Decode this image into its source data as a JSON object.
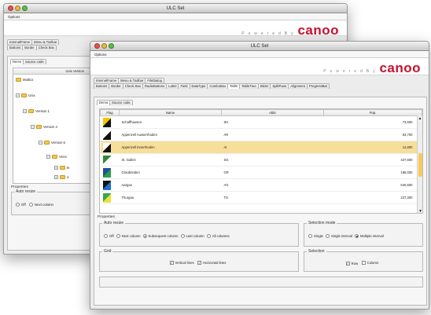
{
  "back_window": {
    "title": "ULC Set",
    "menu": "Options",
    "brand_powered": "P o w e r e d   B y",
    "brand_name": "canoo",
    "tabs_row1": [
      "InternalFrame",
      "Menu & Toolbar"
    ],
    "tabs_row2": [
      "Buttons",
      "Border",
      "Check Box"
    ],
    "subtabs": [
      "Demo",
      "Source code"
    ],
    "tree_header": "Unix Version",
    "tree": [
      "Multics",
      "Unix",
      "Version 1",
      "Version 4",
      "Version 6",
      "Versi",
      "B",
      "4"
    ],
    "properties_title": "Properties",
    "auto_resize_title": "Auto resize",
    "auto_resize_options": [
      "Off",
      "Next column"
    ]
  },
  "front_window": {
    "title": "ULC Set",
    "menu": "Options",
    "brand_powered": "P o w e r e d   B y",
    "brand_name": "canoo",
    "tabs_row1": [
      "InternalFrame",
      "Menu & Toolbar",
      "FileDialog"
    ],
    "tabs_row2": [
      "Buttons",
      "Border",
      "Check Box",
      "RadioButtons",
      "Label",
      "Field",
      "DataType",
      "ComboBox",
      "Table",
      "TableTree",
      "Slider",
      "SplitPane",
      "Alignment",
      "ProgressBar"
    ],
    "subtabs": [
      "Demo",
      "Source code"
    ],
    "table": {
      "columns": [
        "Flag",
        "Name",
        "Abbr",
        "Pop."
      ],
      "rows": [
        {
          "name": "Schaffhausen",
          "abbr": "SH",
          "pop": "73,600",
          "flag_colors": [
            "#f5c400",
            "#111111"
          ]
        },
        {
          "name": "Appenzell Ausserrhoden",
          "abbr": "AR",
          "pop": "53,700",
          "flag_colors": [
            "#ffffff",
            "#111111"
          ]
        },
        {
          "name": "Appenzell Innerrhoden",
          "abbr": "AI",
          "pop": "14,800",
          "flag_colors": [
            "#ffffff",
            "#111111"
          ]
        },
        {
          "name": "St. Gallen",
          "abbr": "SG",
          "pop": "447,600",
          "flag_colors": [
            "#2e8b3a",
            "#ffffff"
          ]
        },
        {
          "name": "Graubünden",
          "abbr": "GR",
          "pop": "186,000",
          "flag_colors": [
            "#1e4fa0",
            "#2e9a4a"
          ]
        },
        {
          "name": "Aargau",
          "abbr": "AG",
          "pop": "540,600",
          "flag_colors": [
            "#111111",
            "#1f6fd0"
          ]
        },
        {
          "name": "Thurgau",
          "abbr": "TG",
          "pop": "227,300",
          "flag_colors": [
            "#3aa64a",
            "#e8e23a"
          ]
        }
      ]
    },
    "properties_title": "Properties",
    "auto_resize": {
      "title": "Auto resize",
      "options": [
        "Off",
        "Next column",
        "Subsequent column",
        "Last column",
        "All columns"
      ],
      "selected": "Subsequent column"
    },
    "selection_mode": {
      "title": "Selection mode",
      "options": [
        "Single",
        "Single interval",
        "Multiple interval"
      ],
      "selected": "Multiple interval"
    },
    "grid": {
      "title": "Grid",
      "vertical_label": "Vertical lines",
      "horizontal_label": "Horizontal lines",
      "vertical_checked": true,
      "horizontal_checked": true
    },
    "selection": {
      "title": "Selection",
      "row_label": "Row",
      "column_label": "Column",
      "row_checked": true,
      "column_checked": false
    }
  },
  "colors": {
    "brand_red": "#c8102e",
    "selected_row": "#f7df9a"
  }
}
